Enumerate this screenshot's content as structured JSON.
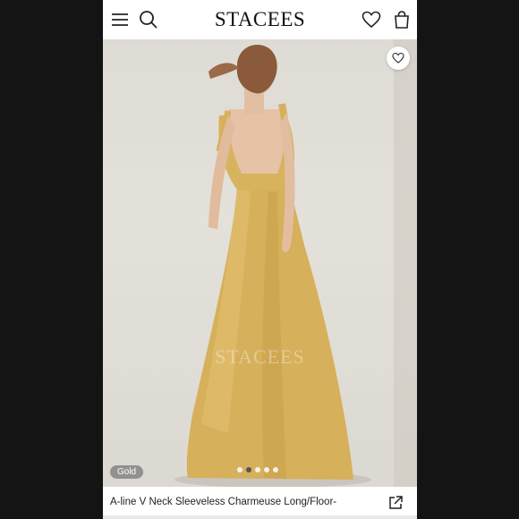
{
  "header": {
    "brand": "STACEES",
    "icons": [
      "menu-icon",
      "search-icon",
      "heart-icon",
      "shopping-bag-icon"
    ]
  },
  "gallery": {
    "watermark": "STACEES",
    "color_label": "Gold",
    "slides_total": 5,
    "active_slide": 1,
    "dress_color": "#d9b45a",
    "favorite_icon": "heart-icon"
  },
  "product": {
    "title": "A-line V Neck Sleeveless Charmeuse Long/Floor-",
    "share_icon": "share-icon"
  }
}
